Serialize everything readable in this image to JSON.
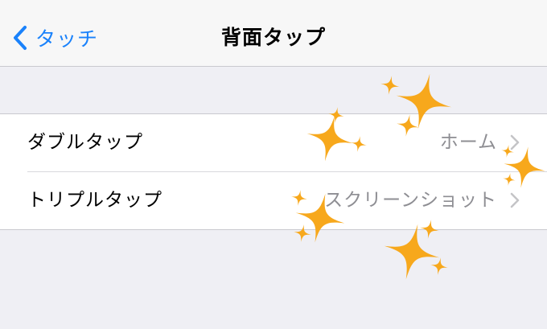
{
  "nav": {
    "back_label": "タッチ",
    "title": "背面タップ"
  },
  "rows": [
    {
      "label": "ダブルタップ",
      "value": "ホーム"
    },
    {
      "label": "トリプルタップ",
      "value": "スクリーンショット"
    }
  ],
  "icons": {
    "back": "chevron-left-icon",
    "disclosure": "chevron-right-icon",
    "decoration": "sparkles-icon"
  },
  "colors": {
    "accent": "#1a82fb",
    "sparkle": "#f7a81c",
    "value_text": "#8e8e93"
  }
}
